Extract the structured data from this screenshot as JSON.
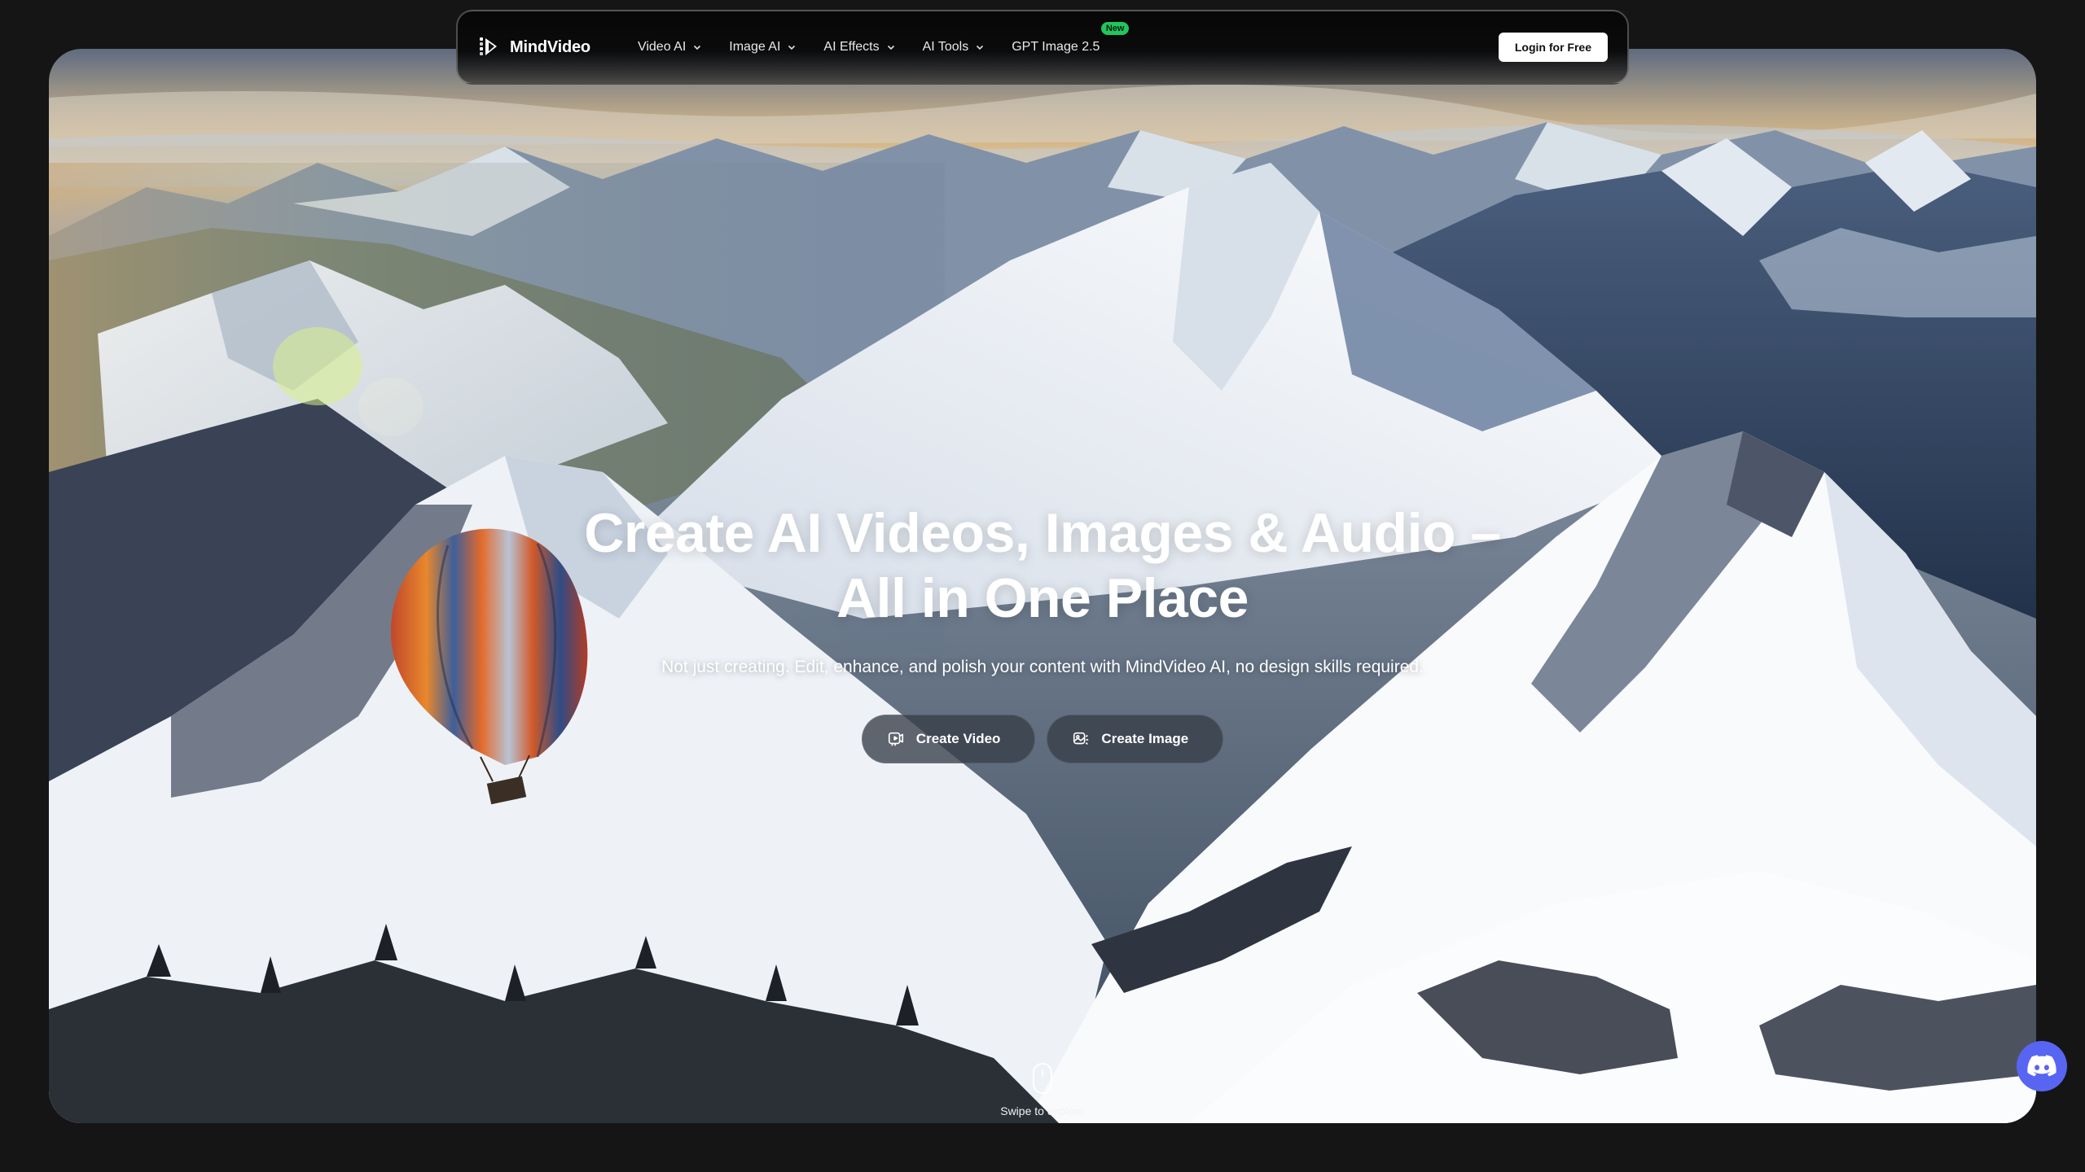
{
  "brand": {
    "name": "MindVideo"
  },
  "nav": {
    "items": [
      {
        "label": "Video AI",
        "dropdown": true
      },
      {
        "label": "Image AI",
        "dropdown": true
      },
      {
        "label": "AI Effects",
        "dropdown": true
      },
      {
        "label": "AI Tools",
        "dropdown": true
      },
      {
        "label": "GPT Image 2.5",
        "badge": "New"
      }
    ],
    "login_label": "Login for Free"
  },
  "hero": {
    "headline_line1": "Create AI Videos, Images & Audio –",
    "headline_line2": "All in One Place",
    "subtitle": "Not just creating. Edit, enhance, and polish your content with MindVideo AI, no design skills required.",
    "buttons": {
      "create_video": "Create Video",
      "create_image": "Create Image"
    },
    "swipe_label": "Swipe to explore"
  },
  "icons": {
    "logo": "mindvideo-logo-icon",
    "chevron": "chevron-down-icon",
    "create_video": "video-icon",
    "create_image": "image-icon",
    "scroll": "mouse-scroll-icon",
    "support": "discord-icon"
  },
  "colors": {
    "page_bg": "#151515",
    "badge_new": "#22c55e",
    "cta_bg": "#373e48",
    "discord": "#5865f2",
    "login_bg": "#ffffff"
  }
}
